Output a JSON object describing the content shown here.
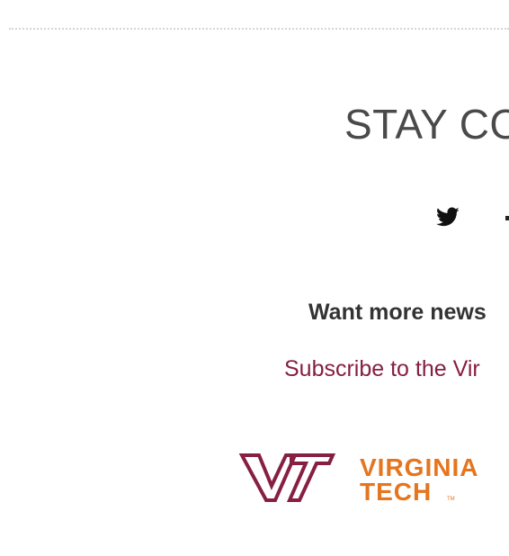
{
  "footer": {
    "stay_connected_heading": "STAY CO",
    "social_icons": [
      "twitter-icon",
      "next-social-icon"
    ],
    "news_prompt": "Want more news",
    "subscribe_link": "Subscribe to the Vir",
    "logo": {
      "line1": "VIRGINIA",
      "line2": "TECH",
      "trademark": "TM"
    }
  },
  "colors": {
    "maroon": "#861f41",
    "orange": "#e5751f",
    "heading_gray": "#4a4a4a",
    "text_dark": "#333333"
  }
}
